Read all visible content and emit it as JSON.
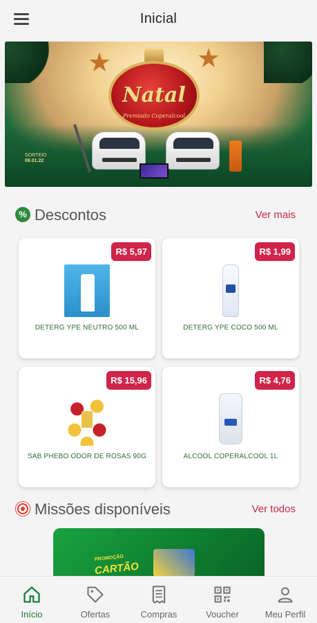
{
  "header": {
    "title": "Inicial",
    "menu_icon": "hamburger-menu-icon"
  },
  "banner": {
    "title": "Natal",
    "subtitle": "Premiado Coperalcool",
    "sorteio_label": "SORTEIO",
    "sorteio_date": "08.01.22"
  },
  "discounts": {
    "title": "Descontos",
    "see_more": "Ver mais",
    "products": [
      {
        "name": "DETERG YPE NEUTRO 500 ML",
        "price": "R$ 5,97"
      },
      {
        "name": "DETERG YPE COCO 500 ML",
        "price": "R$ 1,99"
      },
      {
        "name": "SAB PHEBO ODOR DE ROSAS 90G",
        "price": "R$ 15,96"
      },
      {
        "name": "ALCOOL COPERALCOOL 1L",
        "price": "R$ 4,76"
      }
    ]
  },
  "missions": {
    "title": "Missões disponíveis",
    "see_all": "Ver todos",
    "banner_promo": "PROMOÇÃO",
    "banner_text": "CARTÃO"
  },
  "bottom_nav": {
    "items": [
      {
        "label": "Início",
        "icon": "home-icon",
        "active": true
      },
      {
        "label": "Ofertas",
        "icon": "tag-icon"
      },
      {
        "label": "Compras",
        "icon": "receipt-icon"
      },
      {
        "label": "Voucher",
        "icon": "qr-code-icon"
      },
      {
        "label": "Meu Perfil",
        "icon": "user-icon"
      }
    ]
  },
  "colors": {
    "brand_green": "#1f7d3a",
    "accent_red": "#d0244a",
    "link_red": "#c42a4a"
  }
}
